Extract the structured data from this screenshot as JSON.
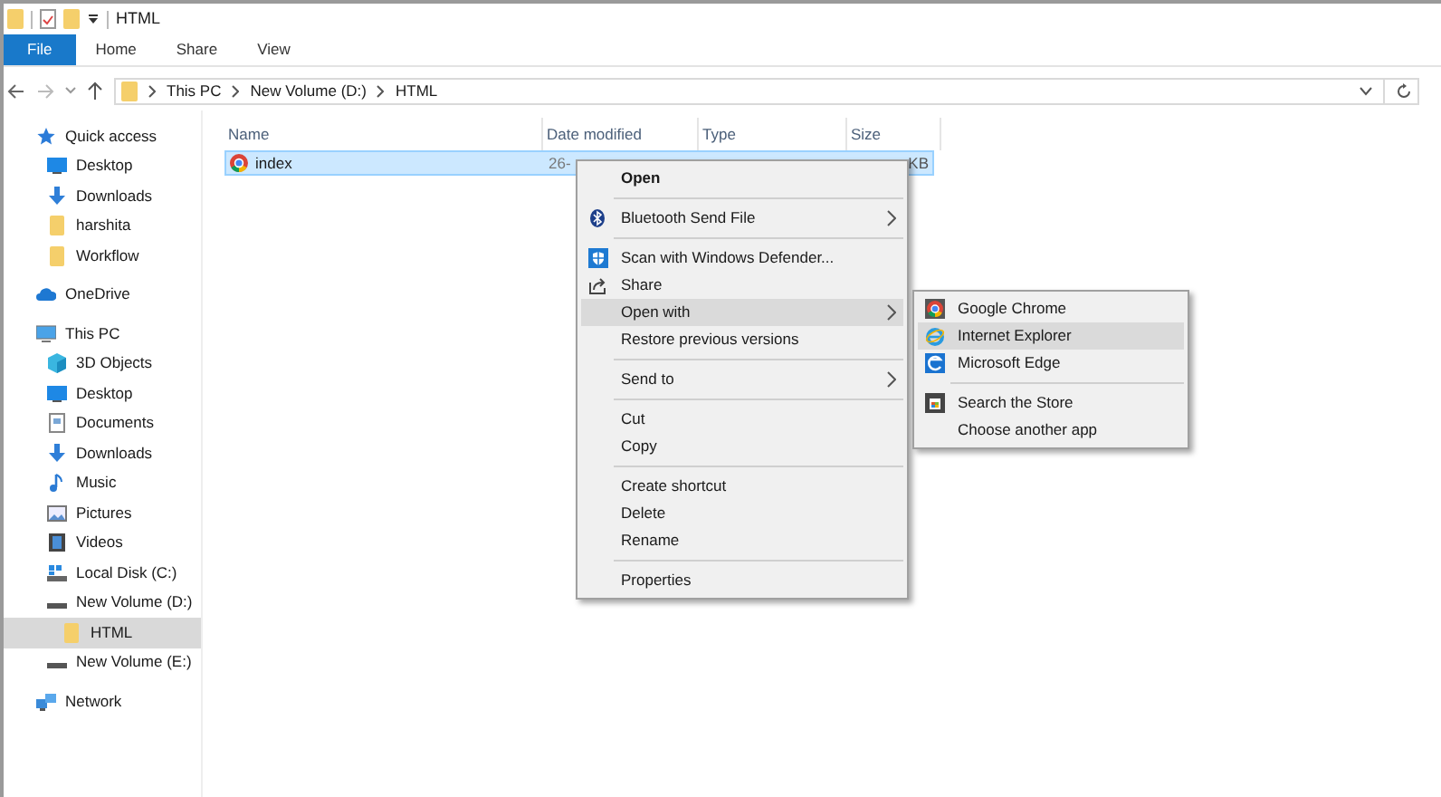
{
  "window": {
    "title": "HTML"
  },
  "ribbon_tabs": [
    {
      "label": "File",
      "kind": "file"
    },
    {
      "label": "Home",
      "kind": "tab"
    },
    {
      "label": "Share",
      "kind": "tab"
    },
    {
      "label": "View",
      "kind": "tab"
    }
  ],
  "address_bar": {
    "breadcrumbs": [
      "This PC",
      "New Volume (D:)",
      "HTML"
    ]
  },
  "sidebar": {
    "items": [
      {
        "label": "Quick access",
        "kind": "star",
        "selected": false,
        "children": [
          {
            "label": "Desktop",
            "kind": "desktop",
            "selected": false
          },
          {
            "label": "Downloads",
            "kind": "download",
            "selected": false
          },
          {
            "label": "harshita",
            "kind": "folder",
            "selected": false
          },
          {
            "label": "Workflow",
            "kind": "folder",
            "selected": false
          }
        ]
      },
      {
        "label": "OneDrive",
        "kind": "cloud",
        "selected": false
      },
      {
        "label": "This PC",
        "kind": "pc",
        "selected": false,
        "children": [
          {
            "label": "3D Objects",
            "kind": "cube",
            "selected": false
          },
          {
            "label": "Desktop",
            "kind": "desktop",
            "selected": false
          },
          {
            "label": "Documents",
            "kind": "document",
            "selected": false
          },
          {
            "label": "Downloads",
            "kind": "download",
            "selected": false
          },
          {
            "label": "Music",
            "kind": "music",
            "selected": false
          },
          {
            "label": "Pictures",
            "kind": "pictures",
            "selected": false
          },
          {
            "label": "Videos",
            "kind": "videos",
            "selected": false
          },
          {
            "label": "Local Disk (C:)",
            "kind": "sysdrive",
            "selected": false
          },
          {
            "label": "New Volume (D:)",
            "kind": "drive",
            "selected": false,
            "children": [
              {
                "label": "HTML",
                "kind": "folder",
                "selected": true
              }
            ]
          },
          {
            "label": "New Volume (E:)",
            "kind": "drive",
            "selected": false
          }
        ]
      },
      {
        "label": "Network",
        "kind": "network",
        "selected": false
      }
    ]
  },
  "file_list": {
    "columns": [
      "Name",
      "Date modified",
      "Type",
      "Size"
    ],
    "rows": [
      {
        "name": "index",
        "date": "26-",
        "size": "KB",
        "selected": true
      }
    ]
  },
  "context_menu": {
    "items": [
      {
        "kind": "item",
        "label": "Open",
        "default": true,
        "submenu": false,
        "selected": false
      },
      {
        "kind": "separator"
      },
      {
        "kind": "bluetooth",
        "label": "Bluetooth Send File",
        "default": false,
        "submenu": true,
        "selected": false
      },
      {
        "kind": "separator"
      },
      {
        "kind": "shield",
        "label": "Scan with Windows Defender...",
        "default": false,
        "submenu": false,
        "selected": false
      },
      {
        "kind": "share",
        "label": "Share",
        "default": false,
        "submenu": false,
        "selected": false
      },
      {
        "kind": "item",
        "label": "Open with",
        "default": false,
        "submenu": true,
        "selected": true
      },
      {
        "kind": "item",
        "label": "Restore previous versions",
        "default": false,
        "submenu": false,
        "selected": false
      },
      {
        "kind": "separator"
      },
      {
        "kind": "item",
        "label": "Send to",
        "default": false,
        "submenu": true,
        "selected": false
      },
      {
        "kind": "separator"
      },
      {
        "kind": "item",
        "label": "Cut",
        "default": false,
        "submenu": false,
        "selected": false
      },
      {
        "kind": "item",
        "label": "Copy",
        "default": false,
        "submenu": false,
        "selected": false
      },
      {
        "kind": "separator"
      },
      {
        "kind": "item",
        "label": "Create shortcut",
        "default": false,
        "submenu": false,
        "selected": false
      },
      {
        "kind": "item",
        "label": "Delete",
        "default": false,
        "submenu": false,
        "selected": false
      },
      {
        "kind": "item",
        "label": "Rename",
        "default": false,
        "submenu": false,
        "selected": false
      },
      {
        "kind": "separator"
      },
      {
        "kind": "item",
        "label": "Properties",
        "default": false,
        "submenu": false,
        "selected": false
      }
    ]
  },
  "open_with_menu": {
    "items": [
      {
        "kind": "chrome",
        "label": "Google Chrome",
        "selected": false
      },
      {
        "kind": "ie",
        "label": "Internet Explorer",
        "selected": true
      },
      {
        "kind": "edge",
        "label": "Microsoft Edge",
        "selected": false
      },
      {
        "kind": "separator"
      },
      {
        "kind": "store",
        "label": "Search the Store",
        "selected": false
      },
      {
        "kind": "item",
        "label": "Choose another app",
        "selected": false
      }
    ]
  }
}
